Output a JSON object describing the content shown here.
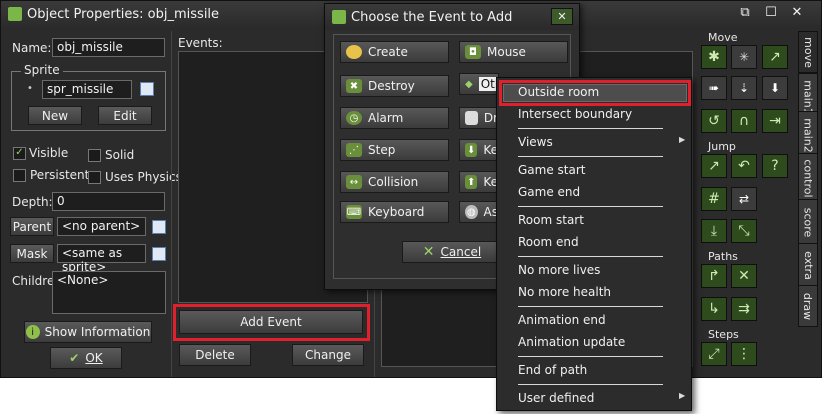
{
  "object_window": {
    "title": "Object Properties: obj_missile",
    "name_label": "Name:",
    "name_value": "obj_missile",
    "sprite_group": "Sprite",
    "sprite_value": "spr_missile",
    "new_label": "New",
    "edit_label": "Edit",
    "visible_label": "Visible",
    "solid_label": "Solid",
    "persistent_label": "Persistent",
    "physics_label": "Uses Physics",
    "depth_label": "Depth:",
    "depth_value": "0",
    "parent_label": "Parent",
    "parent_value": "<no parent>",
    "mask_label": "Mask",
    "mask_value": "<same as sprite>",
    "children_label": "Children:",
    "children_value": "<None>",
    "show_info_label": "Show Information",
    "ok_label": "OK",
    "events_label": "Events:",
    "add_event_label": "Add Event",
    "delete_label": "Delete",
    "change_label": "Change"
  },
  "event_dialog": {
    "title": "Choose the Event to Add",
    "buttons_left": [
      "Create",
      "Destroy",
      "Alarm",
      "Step",
      "Collision",
      "Keyboard"
    ],
    "buttons_right": [
      "Mouse",
      "Oth",
      "Dr",
      "Ke",
      "Ke",
      "As"
    ],
    "cancel_label": "Cancel"
  },
  "other_menu": {
    "items": [
      "Outside room",
      "Intersect boundary",
      "Views",
      "Game start",
      "Game end",
      "Room start",
      "Room end",
      "No more lives",
      "No more health",
      "Animation end",
      "Animation update",
      "End of path",
      "User defined"
    ]
  },
  "actions_panel": {
    "sections": [
      "Move",
      "Jump",
      "Paths",
      "Steps"
    ],
    "tabs": [
      "move",
      "main1",
      "main2",
      "control",
      "score",
      "extra",
      "draw"
    ]
  },
  "colors": {
    "highlight": "#e0202c",
    "window_bg": "#2b2b2b",
    "action_green": "#2e4b1e"
  }
}
